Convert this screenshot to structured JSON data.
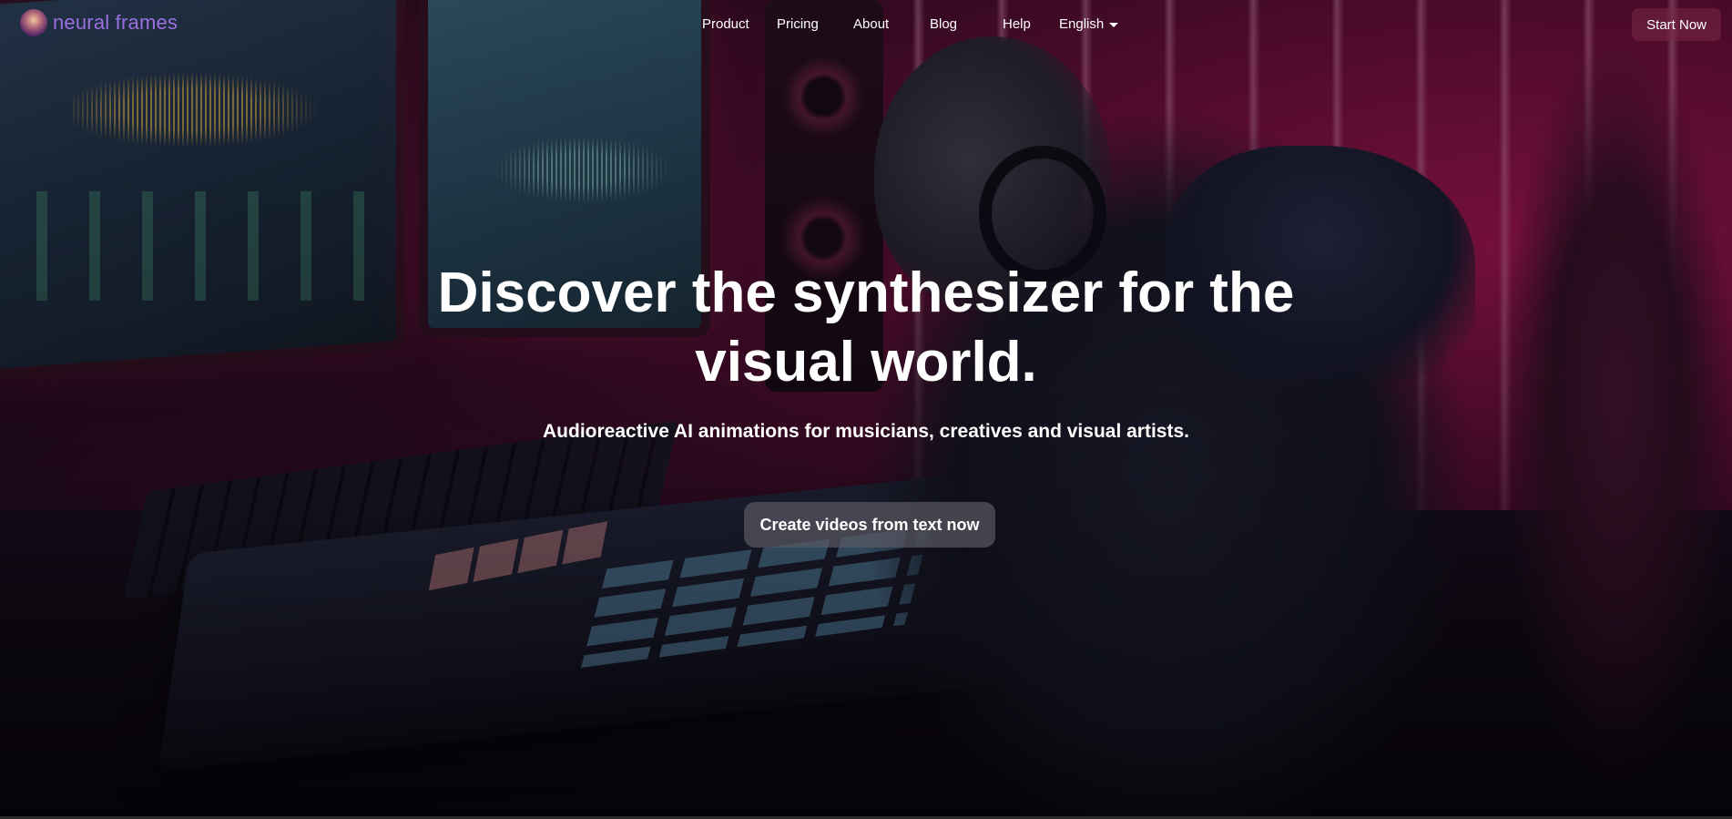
{
  "brand": {
    "name": "neural frames",
    "logo_icon": "squirrel-avatar-icon",
    "color": "#9b6fe0"
  },
  "nav": {
    "items": [
      {
        "label": "Product"
      },
      {
        "label": "Pricing"
      },
      {
        "label": "About"
      },
      {
        "label": "Blog"
      },
      {
        "label": "Help"
      }
    ],
    "language": {
      "selected": "English",
      "icon": "caret-down-icon"
    },
    "cta_label": "Start Now"
  },
  "hero": {
    "title_line1": "Discover the synthesizer for the",
    "title_line2": "visual world.",
    "subtitle": "Audioreactive AI animations for musicians, creatives and visual artists.",
    "cta_label": "Create videos from text now"
  },
  "colors": {
    "accent_pink": "#c2185b",
    "text": "#ffffff",
    "start_button": "#782846"
  }
}
